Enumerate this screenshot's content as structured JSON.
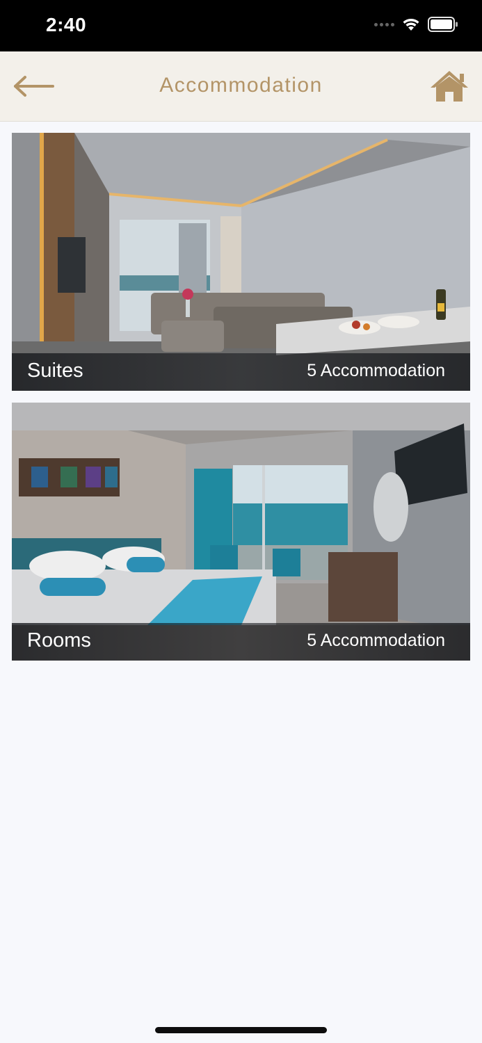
{
  "status_bar": {
    "time": "2:40"
  },
  "header": {
    "title": "Accommodation",
    "accent_color": "#b39467"
  },
  "categories": [
    {
      "name": "Suites",
      "count_label": "5 Accommodation"
    },
    {
      "name": "Rooms",
      "count_label": "5 Accommodation"
    }
  ]
}
